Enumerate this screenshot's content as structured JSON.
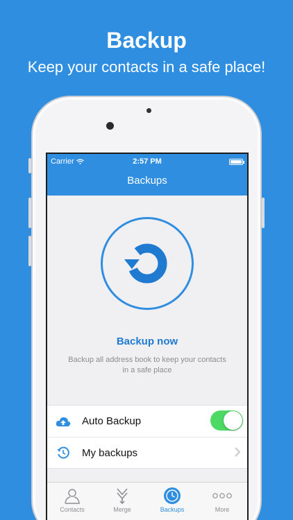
{
  "promo": {
    "title": "Backup",
    "subtitle": "Keep your contacts in a safe place!"
  },
  "status_bar": {
    "carrier": "Carrier",
    "time": "2:57 PM"
  },
  "navbar": {
    "title": "Backups"
  },
  "main": {
    "action_label": "Backup now",
    "description": "Backup all address book to keep your contacts in a safe place"
  },
  "settings": {
    "rows": [
      {
        "label": "Auto Backup",
        "icon": "cloud-upload-icon",
        "control": "toggle",
        "on": true
      },
      {
        "label": "My backups",
        "icon": "history-icon",
        "control": "chevron"
      }
    ]
  },
  "tabbar": {
    "tabs": [
      {
        "label": "Contacts",
        "icon": "person-icon",
        "active": false
      },
      {
        "label": "Merge",
        "icon": "merge-icon",
        "active": false
      },
      {
        "label": "Backups",
        "icon": "clock-icon",
        "active": true
      },
      {
        "label": "More",
        "icon": "more-icon",
        "active": false
      }
    ]
  },
  "colors": {
    "accent": "#2f8ee0",
    "toggle_on": "#4cd964",
    "tab_inactive": "#8e8e93"
  }
}
